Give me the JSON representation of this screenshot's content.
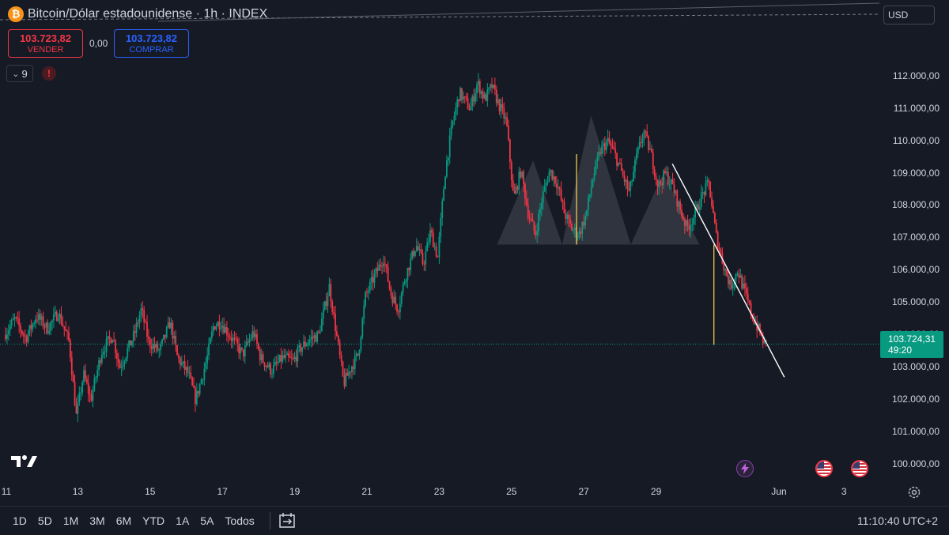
{
  "header": {
    "title": "Bitcoin/Dólar estadounidense · 1h · INDEX",
    "logo_glyph": "₿"
  },
  "trade": {
    "sell_price": "103.723,82",
    "sell_label": "VENDER",
    "spread": "0,00",
    "buy_price": "103.723,82",
    "buy_label": "COMPRAR"
  },
  "indicators": {
    "count": "9",
    "chevron": "⌄",
    "warning": "!"
  },
  "currency": {
    "label": "USD",
    "arrow": "⌄"
  },
  "last_price": {
    "value": "103.724,31",
    "countdown": "49:20"
  },
  "bottom_bar": {
    "ranges": [
      "1D",
      "5D",
      "1M",
      "3M",
      "6M",
      "YTD",
      "1A",
      "5A",
      "Todos"
    ],
    "time": "11:10:40 UTC+2"
  },
  "colors": {
    "up": "#089981",
    "down": "#f23645",
    "pattern": "#787b86",
    "accent": "#2962ff"
  },
  "chart_data": {
    "type": "candlestick",
    "title": "Bitcoin/Dólar estadounidense · 1h · INDEX",
    "x_tick_labels": [
      "11",
      "13",
      "15",
      "17",
      "19",
      "21",
      "23",
      "25",
      "27",
      "29",
      "Jun",
      "3"
    ],
    "y_tick_labels": [
      "100.000,00",
      "101.000,00",
      "102.000,00",
      "103.000,00",
      "104.000,00",
      "105.000,00",
      "106.000,00",
      "107.000,00",
      "108.000,00",
      "109.000,00",
      "110.000,00",
      "111.000,00",
      "112.000,00"
    ],
    "y_ticks": [
      100000,
      101000,
      102000,
      103000,
      104000,
      105000,
      106000,
      107000,
      108000,
      109000,
      110000,
      111000,
      112000
    ],
    "ylim": [
      99700,
      112900
    ],
    "x_range_days": [
      "2025-05-11",
      "2025-06-04"
    ],
    "price_path": [
      {
        "t": 11.0,
        "p": 104000
      },
      {
        "t": 11.3,
        "p": 104500
      },
      {
        "t": 11.6,
        "p": 103900
      },
      {
        "t": 11.9,
        "p": 104600
      },
      {
        "t": 12.2,
        "p": 104200
      },
      {
        "t": 12.5,
        "p": 104700
      },
      {
        "t": 12.8,
        "p": 103800
      },
      {
        "t": 13.0,
        "p": 101500
      },
      {
        "t": 13.2,
        "p": 102800
      },
      {
        "t": 13.4,
        "p": 102000
      },
      {
        "t": 13.7,
        "p": 103500
      },
      {
        "t": 14.0,
        "p": 104000
      },
      {
        "t": 14.2,
        "p": 103000
      },
      {
        "t": 14.6,
        "p": 104000
      },
      {
        "t": 14.8,
        "p": 104800
      },
      {
        "t": 15.0,
        "p": 103800
      },
      {
        "t": 15.3,
        "p": 103500
      },
      {
        "t": 15.6,
        "p": 104400
      },
      {
        "t": 15.8,
        "p": 103300
      },
      {
        "t": 16.1,
        "p": 102800
      },
      {
        "t": 16.3,
        "p": 102000
      },
      {
        "t": 16.6,
        "p": 103200
      },
      {
        "t": 16.8,
        "p": 104300
      },
      {
        "t": 17.0,
        "p": 104400
      },
      {
        "t": 17.3,
        "p": 103900
      },
      {
        "t": 17.6,
        "p": 103400
      },
      {
        "t": 17.9,
        "p": 104100
      },
      {
        "t": 18.1,
        "p": 103300
      },
      {
        "t": 18.4,
        "p": 102900
      },
      {
        "t": 18.7,
        "p": 103300
      },
      {
        "t": 19.0,
        "p": 103200
      },
      {
        "t": 19.2,
        "p": 103600
      },
      {
        "t": 19.5,
        "p": 103900
      },
      {
        "t": 19.7,
        "p": 104000
      },
      {
        "t": 20.0,
        "p": 105500
      },
      {
        "t": 20.2,
        "p": 104000
      },
      {
        "t": 20.4,
        "p": 102500
      },
      {
        "t": 20.6,
        "p": 103000
      },
      {
        "t": 20.8,
        "p": 103400
      },
      {
        "t": 21.0,
        "p": 105200
      },
      {
        "t": 21.2,
        "p": 105700
      },
      {
        "t": 21.5,
        "p": 106400
      },
      {
        "t": 21.7,
        "p": 105300
      },
      {
        "t": 21.9,
        "p": 104800
      },
      {
        "t": 22.1,
        "p": 105800
      },
      {
        "t": 22.4,
        "p": 106800
      },
      {
        "t": 22.6,
        "p": 106200
      },
      {
        "t": 22.8,
        "p": 107200
      },
      {
        "t": 23.0,
        "p": 106400
      },
      {
        "t": 23.2,
        "p": 109000
      },
      {
        "t": 23.4,
        "p": 110500
      },
      {
        "t": 23.6,
        "p": 111500
      },
      {
        "t": 23.9,
        "p": 111000
      },
      {
        "t": 24.1,
        "p": 111800
      },
      {
        "t": 24.3,
        "p": 111300
      },
      {
        "t": 24.5,
        "p": 111700
      },
      {
        "t": 24.7,
        "p": 111100
      },
      {
        "t": 24.9,
        "p": 110600
      },
      {
        "t": 25.1,
        "p": 108200
      },
      {
        "t": 25.3,
        "p": 109100
      },
      {
        "t": 25.5,
        "p": 107800
      },
      {
        "t": 25.7,
        "p": 107100
      },
      {
        "t": 25.9,
        "p": 108300
      },
      {
        "t": 26.1,
        "p": 109100
      },
      {
        "t": 26.3,
        "p": 108700
      },
      {
        "t": 26.5,
        "p": 107800
      },
      {
        "t": 26.7,
        "p": 107300
      },
      {
        "t": 26.9,
        "p": 107100
      },
      {
        "t": 27.1,
        "p": 107700
      },
      {
        "t": 27.3,
        "p": 108900
      },
      {
        "t": 27.5,
        "p": 109700
      },
      {
        "t": 27.7,
        "p": 110000
      },
      {
        "t": 27.9,
        "p": 109600
      },
      {
        "t": 28.1,
        "p": 109000
      },
      {
        "t": 28.3,
        "p": 108400
      },
      {
        "t": 28.5,
        "p": 109500
      },
      {
        "t": 28.7,
        "p": 110300
      },
      {
        "t": 28.9,
        "p": 109600
      },
      {
        "t": 29.1,
        "p": 108600
      },
      {
        "t": 29.3,
        "p": 109000
      },
      {
        "t": 29.5,
        "p": 108600
      },
      {
        "t": 29.7,
        "p": 107900
      },
      {
        "t": 29.9,
        "p": 107300
      },
      {
        "t": 30.1,
        "p": 107700
      },
      {
        "t": 30.3,
        "p": 108300
      },
      {
        "t": 30.5,
        "p": 108700
      },
      {
        "t": 30.7,
        "p": 107100
      },
      {
        "t": 30.9,
        "p": 106200
      },
      {
        "t": 31.1,
        "p": 105500
      },
      {
        "t": 31.3,
        "p": 106000
      },
      {
        "t": 31.5,
        "p": 105300
      },
      {
        "t": 31.7,
        "p": 104600
      },
      {
        "t": 31.9,
        "p": 104100
      },
      {
        "t": 32.05,
        "p": 103700
      }
    ],
    "head_and_shoulders": {
      "left_shoulder": {
        "t": 25.6,
        "p": 109400
      },
      "head": {
        "t": 27.2,
        "p": 110800
      },
      "right_shoulder": {
        "t": 29.2,
        "p": 109000
      },
      "neckline": {
        "t0": 24.6,
        "t1": 30.2,
        "p": 106800
      }
    },
    "trendline": {
      "t0": 29.45,
      "p0": 109300,
      "t1": 32.55,
      "p1": 102700
    },
    "markers": [
      {
        "t": 26.8,
        "p_top": 109600,
        "p_bottom": 106800
      },
      {
        "t": 30.6,
        "p_top": 106800,
        "p_bottom": 103700
      }
    ],
    "last_price": 103724.31,
    "grid": false,
    "legend": "none"
  }
}
